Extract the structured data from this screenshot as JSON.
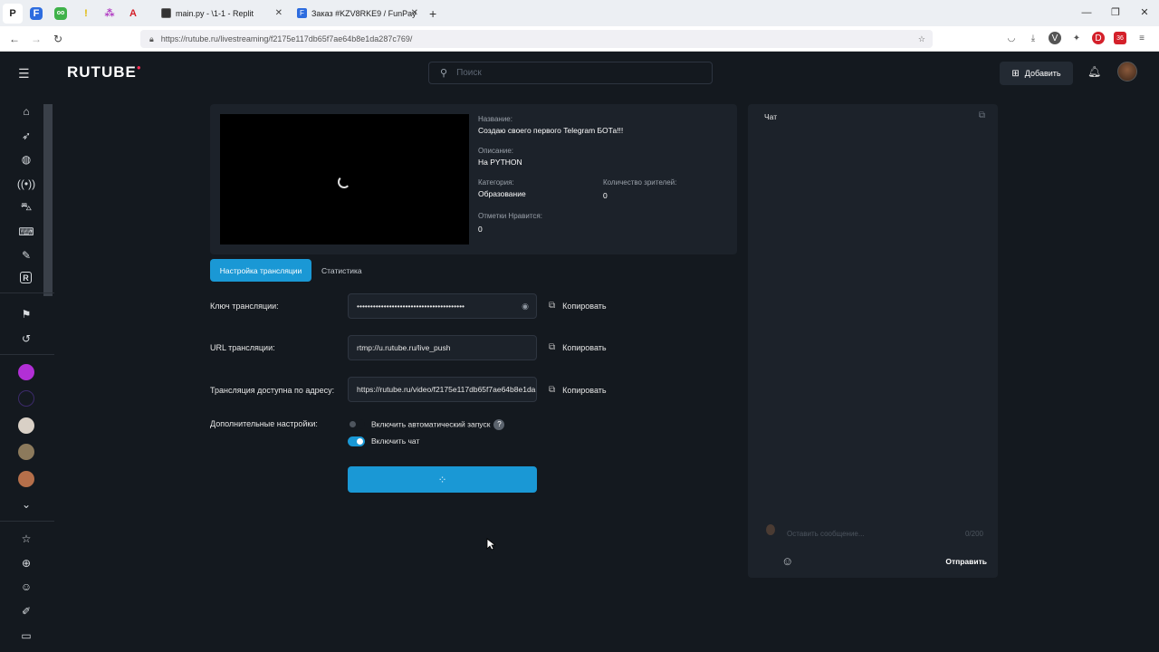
{
  "browser": {
    "pinned_tabs": [
      "P",
      "F",
      "oo",
      "!",
      "⁂",
      "A"
    ],
    "tabs": [
      {
        "title": "main.py - \\1-1 - Replit",
        "icon": "replit-icon"
      },
      {
        "title": "Заказ #KZV8RKE9 / FunPay",
        "icon": "funpay-icon"
      }
    ],
    "url": "https://rutube.ru/livestreaming/f2175e117db65f7ae64b8e1da287c769/"
  },
  "header": {
    "logo": "RUTUBE",
    "search_placeholder": "Поиск",
    "add_label": "Добавить"
  },
  "stream": {
    "name_label": "Название:",
    "name_value": "Создаю своего первого Telegram БОТа!!!",
    "desc_label": "Описание:",
    "desc_value": "На PYTHON",
    "category_label": "Категория:",
    "category_value": "Образование",
    "viewers_label": "Количество зрителей:",
    "viewers_value": "0",
    "likes_label": "Отметки Нравится:",
    "likes_value": "0"
  },
  "tabs": {
    "settings": "Настройка трансляции",
    "stats": "Статистика"
  },
  "form": {
    "key_label": "Ключ трансляции:",
    "key_value": "••••••••••••••••••••••••••••••••••••••••",
    "url_label": "URL трансляции:",
    "url_value": "rtmp://u.rutube.ru/live_push",
    "public_label": "Трансляция доступна по адресу:",
    "public_value": "https://rutube.ru/video/f2175e117db65f7ae64b8e1da",
    "copy_label": "Копировать",
    "extra_label": "Дополнительные настройки:",
    "autostart_label": "Включить автоматический запуск",
    "autostart_on": false,
    "chat_label": "Включить чат",
    "chat_on": true,
    "help_glyph": "?"
  },
  "chat": {
    "title": "Чат",
    "placeholder": "Оставить сообщение...",
    "counter": "0/200",
    "send_label": "Отправить"
  },
  "colors": {
    "accent": "#1a98d5",
    "background": "#14191f",
    "panel": "#1c222a"
  }
}
